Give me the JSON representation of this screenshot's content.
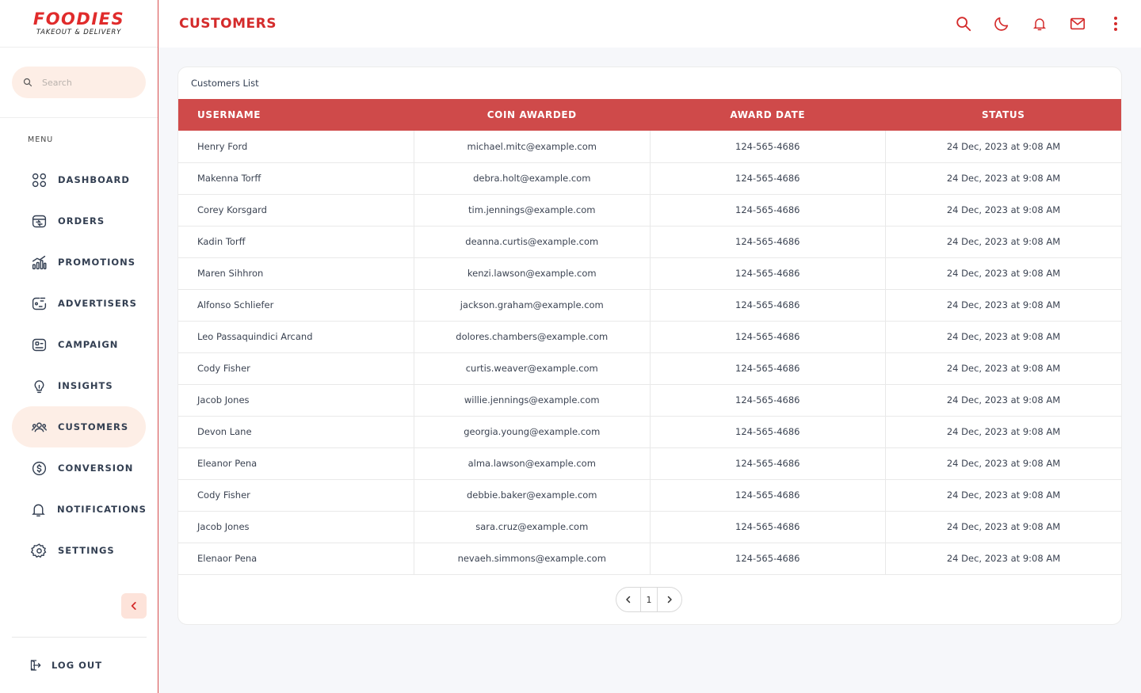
{
  "brand": {
    "title": "FOODIES",
    "subtitle": "TAKEOUT & DELIVERY"
  },
  "search": {
    "placeholder": "Search"
  },
  "sidebar": {
    "menu_label": "MENU",
    "items": [
      {
        "label": "DASHBOARD",
        "icon": "dashboard-icon"
      },
      {
        "label": "ORDERS",
        "icon": "orders-icon"
      },
      {
        "label": "PROMOTIONS",
        "icon": "promotions-icon"
      },
      {
        "label": "ADVERTISERS",
        "icon": "advertisers-icon"
      },
      {
        "label": "CAMPAIGN",
        "icon": "campaign-icon"
      },
      {
        "label": "INSIGHTS",
        "icon": "lightbulb-icon"
      },
      {
        "label": "CUSTOMERS",
        "icon": "customers-icon",
        "active": true
      },
      {
        "label": "CONVERSION",
        "icon": "dollar-icon"
      },
      {
        "label": "NOTIFICATIONS",
        "icon": "bell-icon"
      },
      {
        "label": "SETTINGS",
        "icon": "gear-icon"
      }
    ],
    "logout_label": "LOG OUT"
  },
  "header": {
    "title": "CUSTOMERS"
  },
  "card": {
    "title": "Customers List"
  },
  "table": {
    "columns": [
      "USERNAME",
      "COIN AWARDED",
      "AWARD DATE",
      "STATUS"
    ],
    "rows": [
      [
        "Henry Ford",
        "michael.mitc@example.com",
        "124-565-4686",
        "24 Dec, 2023 at 9:08 AM"
      ],
      [
        "Makenna Torff",
        "debra.holt@example.com",
        "124-565-4686",
        "24 Dec, 2023 at 9:08 AM"
      ],
      [
        "Corey Korsgard",
        "tim.jennings@example.com",
        "124-565-4686",
        "24 Dec, 2023 at 9:08 AM"
      ],
      [
        "Kadin Torff",
        "deanna.curtis@example.com",
        "124-565-4686",
        "24 Dec, 2023 at 9:08 AM"
      ],
      [
        "Maren Sihhron",
        "kenzi.lawson@example.com",
        "124-565-4686",
        "24 Dec, 2023 at 9:08 AM"
      ],
      [
        "Alfonso Schliefer",
        "jackson.graham@example.com",
        "124-565-4686",
        "24 Dec, 2023 at 9:08 AM"
      ],
      [
        "Leo Passaquindici Arcand",
        "dolores.chambers@example.com",
        "124-565-4686",
        "24 Dec, 2023 at 9:08 AM"
      ],
      [
        "Cody Fisher",
        "curtis.weaver@example.com",
        "124-565-4686",
        "24 Dec, 2023 at 9:08 AM"
      ],
      [
        "Jacob Jones",
        "willie.jennings@example.com",
        "124-565-4686",
        "24 Dec, 2023 at 9:08 AM"
      ],
      [
        "Devon Lane",
        "georgia.young@example.com",
        "124-565-4686",
        "24 Dec, 2023 at 9:08 AM"
      ],
      [
        "Eleanor Pena",
        "alma.lawson@example.com",
        "124-565-4686",
        "24 Dec, 2023 at 9:08 AM"
      ],
      [
        "Cody Fisher",
        "debbie.baker@example.com",
        "124-565-4686",
        "24 Dec, 2023 at 9:08 AM"
      ],
      [
        "Jacob Jones",
        "sara.cruz@example.com",
        "124-565-4686",
        "24 Dec, 2023 at 9:08 AM"
      ],
      [
        "Elenaor Pena",
        "nevaeh.simmons@example.com",
        "124-565-4686",
        "24 Dec, 2023 at 9:08 AM"
      ]
    ]
  },
  "pagination": {
    "current_page": "1"
  },
  "colors": {
    "accent": "#d42b2b",
    "header_bg": "#cf4a4a",
    "active_bg": "#fdeee6",
    "nav_text": "#333f52"
  }
}
